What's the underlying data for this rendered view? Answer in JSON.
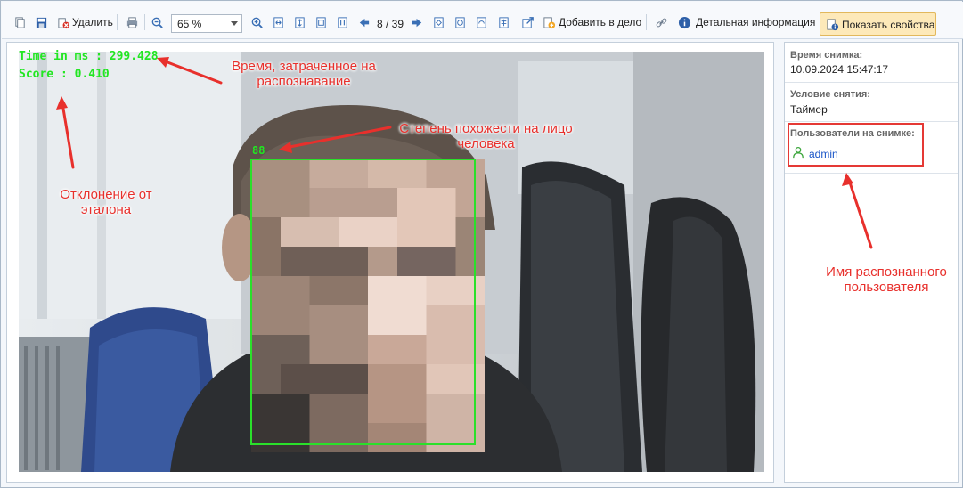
{
  "toolbar": {
    "delete_label": "Удалить",
    "zoom_value": "65 %",
    "page_indicator": "8 / 39",
    "add_to_case_label": "Добавить в дело",
    "details_label": "Детальная информация",
    "show_props_label": "Показать свойства",
    "icons": [
      "copy-icon",
      "save-icon",
      "delete-icon",
      "print-icon",
      "zoom-out-icon",
      "zoom-in-icon",
      "fit-width-icon",
      "fit-height-icon",
      "fit-page-icon",
      "actual-size-icon",
      "prev-icon",
      "next-icon",
      "rotate-icon",
      "flip-icon",
      "crop-icon",
      "export-icon",
      "open-external-icon",
      "folder-add-icon",
      "link-icon",
      "info-icon"
    ]
  },
  "overlay": {
    "time_text": "Time in ms : 299.428",
    "score_text": "Score : 0.410",
    "similarity_text": "88"
  },
  "annotations": {
    "time_note": "Время, затраченное на распознавание",
    "similarity_note": "Степень похожести на лицо человека",
    "deviation_note": "Отклонение от эталона",
    "user_note": "Имя распознанного пользователя"
  },
  "properties": {
    "snapshot_time_label": "Время снимка:",
    "snapshot_time_value": "10.09.2024  15:47:17",
    "capture_condition_label": "Условие снятия:",
    "capture_condition_value": "Таймер",
    "users_label": "Пользователи на снимке:",
    "user_name": "admin"
  },
  "colors": {
    "overlay_green": "#22e622",
    "annotation_red": "#e8302c",
    "link_blue": "#1a56c8",
    "active_button": "#fde9b9"
  }
}
